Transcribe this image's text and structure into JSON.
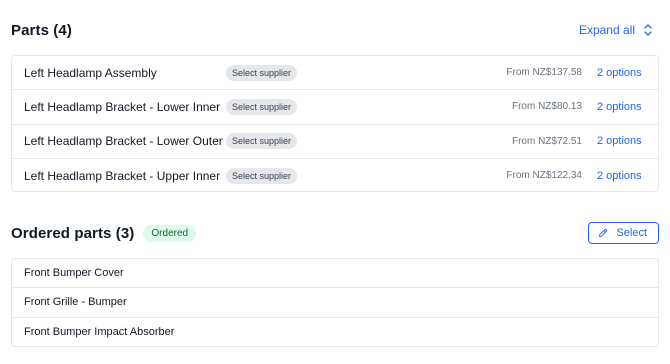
{
  "parts": {
    "title": "Parts (4)",
    "expand_all_label": "Expand all",
    "expand_icon": "chevron-up-down-icon",
    "items": [
      {
        "name": "Left Headlamp Assembly",
        "supplier_label": "Select supplier",
        "price": "From NZ$137.58",
        "options_label": "2 options"
      },
      {
        "name": "Left Headlamp Bracket - Lower Inner",
        "supplier_label": "Select supplier",
        "price": "From NZ$80.13",
        "options_label": "2 options"
      },
      {
        "name": "Left Headlamp Bracket - Lower Outer",
        "supplier_label": "Select supplier",
        "price": "From NZ$72.51",
        "options_label": "2 options"
      },
      {
        "name": "Left Headlamp Bracket - Upper Inner",
        "supplier_label": "Select supplier",
        "price": "From NZ$122.34",
        "options_label": "2 options"
      }
    ]
  },
  "ordered_parts": {
    "title": "Ordered parts (3)",
    "badge": "Ordered",
    "select_label": "Select",
    "select_icon": "pencil-icon",
    "items": [
      {
        "name": "Front Bumper Cover"
      },
      {
        "name": "Front Grille - Bumper"
      },
      {
        "name": "Front Bumper Impact Absorber"
      }
    ]
  },
  "colors": {
    "accent": "#2563eb",
    "badge_bg": "#e5e7eb",
    "ordered_badge_bg": "#dcfce7",
    "ordered_badge_text": "#166534",
    "border": "#e5e7eb"
  }
}
